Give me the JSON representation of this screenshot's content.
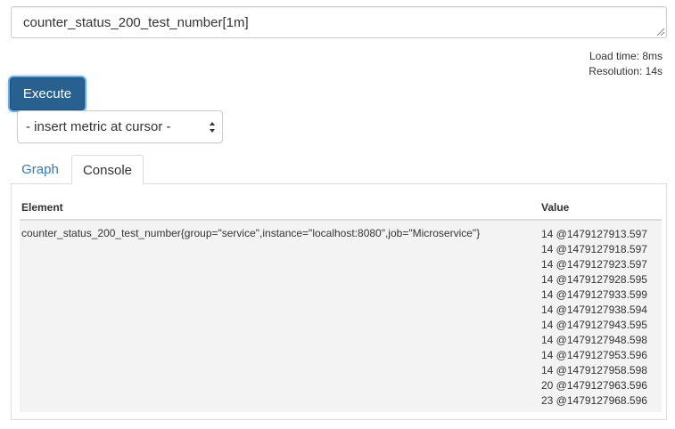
{
  "expression": {
    "value": "counter_status_200_test_number[1m]"
  },
  "stats": {
    "load_time": "Load time: 8ms",
    "resolution": "Resolution: 14s"
  },
  "execute_label": "Execute",
  "metric_select": {
    "selected": "- insert metric at cursor -"
  },
  "tabs": [
    {
      "label": "Graph",
      "active": false
    },
    {
      "label": "Console",
      "active": true
    }
  ],
  "table": {
    "headers": {
      "element": "Element",
      "value": "Value"
    },
    "rows": [
      {
        "element": "counter_status_200_test_number{group=\"service\",instance=\"localhost:8080\",job=\"Microservice\"}",
        "values": [
          "14 @1479127913.597",
          "14 @1479127918.597",
          "14 @1479127923.597",
          "14 @1479127928.595",
          "14 @1479127933.599",
          "14 @1479127938.594",
          "14 @1479127943.595",
          "14 @1479127948.598",
          "14 @1479127953.596",
          "14 @1479127958.598",
          "20 @1479127963.596",
          "23 @1479127968.596"
        ]
      }
    ]
  },
  "colors": {
    "accent": "#286090",
    "link": "#337ab7",
    "row_bg": "#f3f3f3"
  }
}
